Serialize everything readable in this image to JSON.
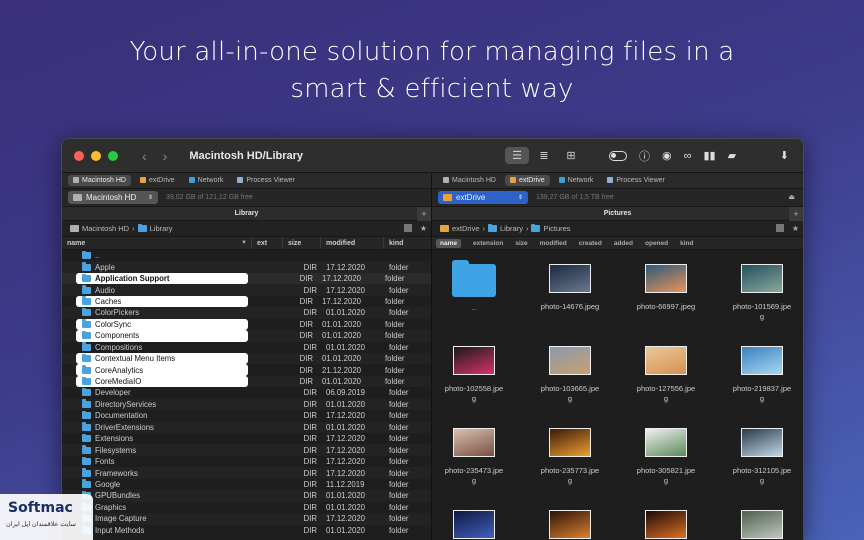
{
  "headline": {
    "line1": "Your all-in-one solution for managing files in a",
    "line2": "smart & efficient way"
  },
  "window": {
    "title": "Macintosh HD/Library",
    "traffic_lights": [
      "#fe5f57",
      "#febc2e",
      "#28c840"
    ],
    "nav_back": "‹",
    "nav_forward": "›"
  },
  "left_pane": {
    "tabs": [
      {
        "label": "Macintosh HD",
        "active": true,
        "icon": "hd-icon"
      },
      {
        "label": "extDrive",
        "active": false,
        "icon": "drive-icon"
      },
      {
        "label": "Network",
        "active": false,
        "icon": "globe-icon"
      },
      {
        "label": "Process Viewer",
        "active": false,
        "icon": "process-icon"
      }
    ],
    "volume": "Macintosh HD",
    "volume_free": "39,02 GB of 121,12 GB free",
    "header": "Library",
    "breadcrumb": [
      "Macintosh HD",
      "Library"
    ],
    "columns": {
      "name": "name",
      "ext": "ext",
      "size": "size",
      "modified": "modified",
      "kind": "kind"
    },
    "files": [
      {
        "name": "..",
        "size": "",
        "modified": "",
        "kind": ""
      },
      {
        "name": "Apple",
        "size": "DIR",
        "modified": "17.12.2020",
        "kind": "folder"
      },
      {
        "name": "Application Support",
        "size": "DIR",
        "modified": "17.12.2020",
        "kind": "folder",
        "selected": true,
        "bold": true,
        "cursor": true
      },
      {
        "name": "Audio",
        "size": "DIR",
        "modified": "17.12.2020",
        "kind": "folder"
      },
      {
        "name": "Caches",
        "size": "DIR",
        "modified": "17.12.2020",
        "kind": "folder",
        "selected": true
      },
      {
        "name": "ColorPickers",
        "size": "DIR",
        "modified": "01.01.2020",
        "kind": "folder"
      },
      {
        "name": "ColorSync",
        "size": "DIR",
        "modified": "01.01.2020",
        "kind": "folder",
        "selected": true
      },
      {
        "name": "Components",
        "size": "DIR",
        "modified": "01.01.2020",
        "kind": "folder",
        "selected": true
      },
      {
        "name": "Compositions",
        "size": "DIR",
        "modified": "01.01.2020",
        "kind": "folder"
      },
      {
        "name": "Contextual Menu Items",
        "size": "DIR",
        "modified": "01.01.2020",
        "kind": "folder",
        "selected": true
      },
      {
        "name": "CoreAnalytics",
        "size": "DIR",
        "modified": "21.12.2020",
        "kind": "folder",
        "selected": true
      },
      {
        "name": "CoreMediaIO",
        "size": "DIR",
        "modified": "01.01.2020",
        "kind": "folder",
        "selected": true
      },
      {
        "name": "Developer",
        "size": "DIR",
        "modified": "06.09.2019",
        "kind": "folder"
      },
      {
        "name": "DirectoryServices",
        "size": "DIR",
        "modified": "01.01.2020",
        "kind": "folder"
      },
      {
        "name": "Documentation",
        "size": "DIR",
        "modified": "17.12.2020",
        "kind": "folder"
      },
      {
        "name": "DriverExtensions",
        "size": "DIR",
        "modified": "01.01.2020",
        "kind": "folder"
      },
      {
        "name": "Extensions",
        "size": "DIR",
        "modified": "17.12.2020",
        "kind": "folder"
      },
      {
        "name": "Filesystems",
        "size": "DIR",
        "modified": "17.12.2020",
        "kind": "folder"
      },
      {
        "name": "Fonts",
        "size": "DIR",
        "modified": "17.12.2020",
        "kind": "folder"
      },
      {
        "name": "Frameworks",
        "size": "DIR",
        "modified": "17.12.2020",
        "kind": "folder"
      },
      {
        "name": "Google",
        "size": "DIR",
        "modified": "11.12.2019",
        "kind": "folder"
      },
      {
        "name": "GPUBundles",
        "size": "DIR",
        "modified": "01.01.2020",
        "kind": "folder"
      },
      {
        "name": "Graphics",
        "size": "DIR",
        "modified": "01.01.2020",
        "kind": "folder"
      },
      {
        "name": "Image Capture",
        "size": "DIR",
        "modified": "17.12.2020",
        "kind": "folder"
      },
      {
        "name": "Input Methods",
        "size": "DIR",
        "modified": "01.01.2020",
        "kind": "folder"
      }
    ]
  },
  "right_pane": {
    "tabs": [
      {
        "label": "extDrive",
        "active": true,
        "icon": "drive-icon"
      },
      {
        "label": "Network",
        "active": false,
        "icon": "globe-icon"
      },
      {
        "label": "Process Viewer",
        "active": false,
        "icon": "process-icon"
      }
    ],
    "tab_first": "Macintosh HD",
    "volume": "extDrive",
    "volume_free": "139,27 GB of 1,5 TB free",
    "header": "Pictures",
    "breadcrumb": [
      "extDrive",
      "Library",
      "Pictures"
    ],
    "columns": [
      "name",
      "extension",
      "size",
      "modified",
      "created",
      "added",
      "opened",
      "kind"
    ],
    "items": [
      {
        "name": "..",
        "colors": [
          "#3ea4e6",
          "#3ea4e6"
        ],
        "folder": true
      },
      {
        "name": "photo-14676.jpeg",
        "colors": [
          "#1a2a40",
          "#6a7890"
        ]
      },
      {
        "name": "photo-66997.jpeg",
        "colors": [
          "#2d5a7a",
          "#e8935a"
        ]
      },
      {
        "name": "photo-101569.jpe\ng",
        "colors": [
          "#24505a",
          "#8aa8a0"
        ]
      },
      {
        "name": "photo-102558.jpe\ng",
        "colors": [
          "#1a1a1a",
          "#d8336a"
        ]
      },
      {
        "name": "photo-103665.jpe\ng",
        "colors": [
          "#8a9ab0",
          "#c8a070"
        ]
      },
      {
        "name": "photo-127556.jpe\ng",
        "colors": [
          "#e8c89a",
          "#d89050"
        ]
      },
      {
        "name": "photo-219837.jpe\ng",
        "colors": [
          "#3a80c0",
          "#a8d8f0"
        ]
      },
      {
        "name": "photo-235473.jpe\ng",
        "colors": [
          "#d8c0b0",
          "#7a5040"
        ]
      },
      {
        "name": "photo-235773.jpe\ng",
        "colors": [
          "#3a1a0a",
          "#f0a030"
        ]
      },
      {
        "name": "photo-305821.jpe\ng",
        "colors": [
          "#f0f0f0",
          "#5a8a5a"
        ]
      },
      {
        "name": "photo-312105.jpe\ng",
        "colors": [
          "#2a3a4a",
          "#c0d8e8"
        ]
      },
      {
        "name": "",
        "colors": [
          "#101840",
          "#4060c0"
        ]
      },
      {
        "name": "",
        "colors": [
          "#2a1408",
          "#e08030"
        ]
      },
      {
        "name": "",
        "colors": [
          "#1a0a0a",
          "#e07020"
        ]
      },
      {
        "name": "",
        "colors": [
          "#506050",
          "#c0c8c0"
        ]
      }
    ]
  },
  "watermark": {
    "title": "Softmac",
    "subtitle": "سایت علاقمندان اپل ایران"
  }
}
